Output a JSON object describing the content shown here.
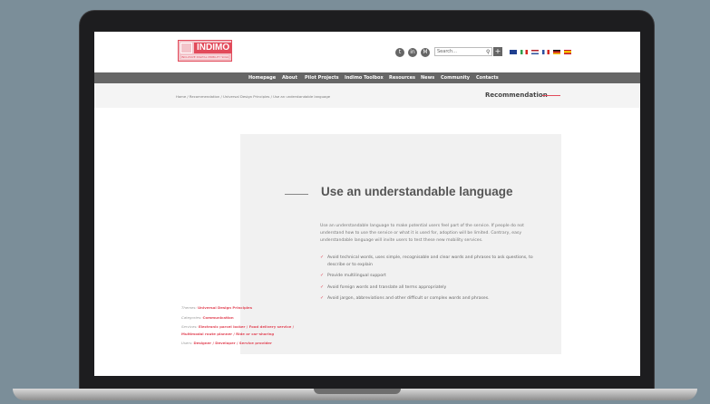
{
  "logo": {
    "name": "INDIMO",
    "tagline": "INCLUSIVE DIGITAL MOBILITY SOLUTIONS"
  },
  "social": [
    {
      "icon": "twitter-icon",
      "glyph": "t"
    },
    {
      "icon": "linkedin-icon",
      "glyph": "in"
    },
    {
      "icon": "medium-icon",
      "glyph": "M"
    }
  ],
  "search": {
    "placeholder": "Search..."
  },
  "flags": [
    {
      "lang": "en",
      "color": "#1f3f8f"
    },
    {
      "lang": "it",
      "color": "#2f9e4a"
    },
    {
      "lang": "nl",
      "color": "#3b5ea8"
    },
    {
      "lang": "fr",
      "color": "#2c4fa0"
    },
    {
      "lang": "de",
      "color": "#d5261f"
    },
    {
      "lang": "es",
      "color": "#e8a317"
    }
  ],
  "nav": [
    "Homepage",
    "About",
    "Pilot Projects",
    "Indimo Toolbox",
    "Resources",
    "News",
    "Community",
    "Contacts"
  ],
  "breadcrumb": "Home / Recommendation / Universal Design Principles / Use an understandable language",
  "section_title": "Recommendation",
  "article": {
    "title": "Use an understandable language",
    "intro": "Use an understandable language to make potential users feel part of the service. If people do not understand how to use the service or what it is used for, adoption will be limited. Contrary, easy understandable language will invite users to test these new mobility services.",
    "bullets": [
      "Avoid technical words, uses simple, recognisable and clear words and phrases to ask questions, to describe or to explain",
      "Provide multilingual support",
      "Avoid foreign words and translate all terms appropriately",
      "Avoid jargon, abbreviations and other difficult or complex words and phrases."
    ]
  },
  "meta": {
    "themes_label": "Themes:",
    "themes": "Universal Design Principles",
    "categories_label": "Categories:",
    "categories": "Communication",
    "services_label": "Services:",
    "services": "Electronic parcel locker / Food delivery service / Multimodal route planner / Ride or car-sharing",
    "users_label": "Users:",
    "users": "Designer / Developer / Service provider"
  },
  "colors": {
    "accent": "#e24b5b",
    "nav_bg": "#666666",
    "background": "#7b8e99"
  }
}
